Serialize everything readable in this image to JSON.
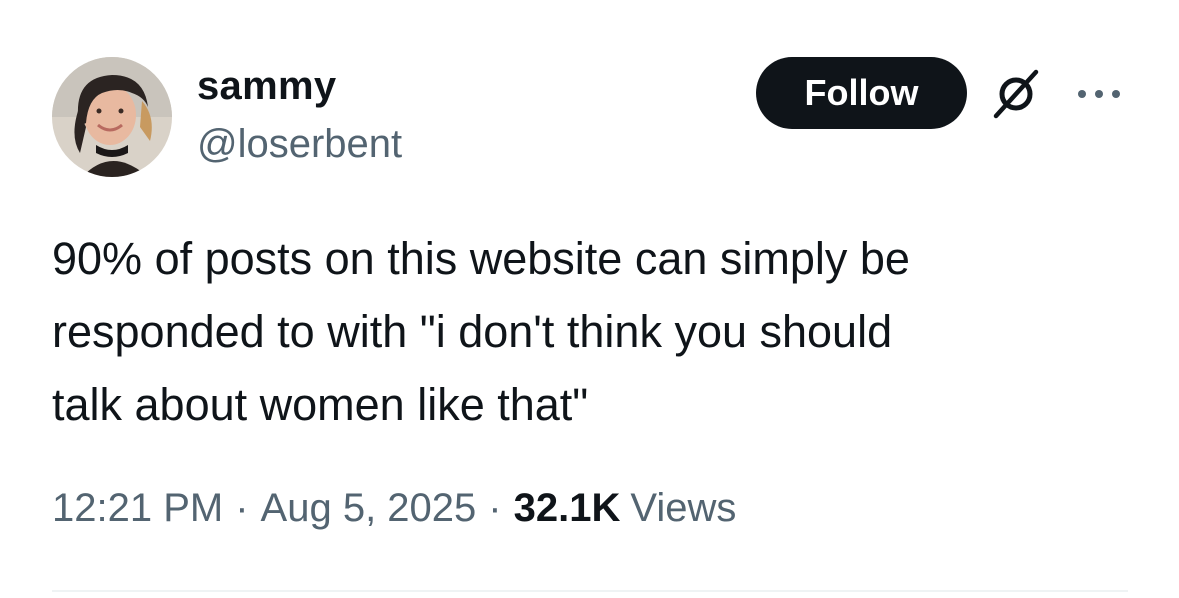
{
  "author": {
    "display_name": "sammy",
    "handle": "@loserbent",
    "avatar_icon": "user-avatar-photo"
  },
  "actions": {
    "follow_label": "Follow",
    "grok_icon": "grok-icon",
    "more_icon": "more-horizontal-icon"
  },
  "post": {
    "text": "90% of posts on this website can simply be\nresponded to with \"i don't think you should\ntalk about women like that\""
  },
  "meta": {
    "time": "12:21 PM",
    "separator": "·",
    "date": "Aug 5, 2025",
    "views_count": "32.1K",
    "views_label": "Views"
  },
  "colors": {
    "text_primary": "#0f1419",
    "text_secondary": "#536471",
    "button_bg": "#0f1419",
    "divider": "#eff3f4"
  }
}
